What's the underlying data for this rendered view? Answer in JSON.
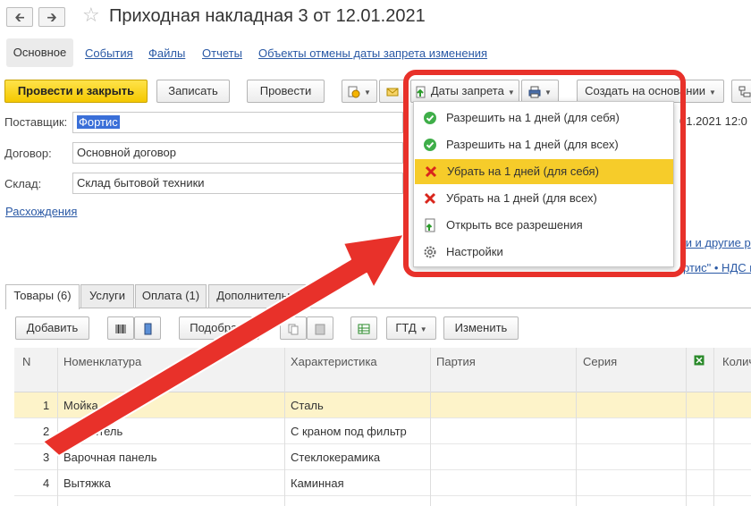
{
  "window": {
    "title": "Приходная накладная 3 от 12.01.2021",
    "back_icon": "arrow-left-icon",
    "forward_icon": "arrow-right-icon",
    "favorite_icon": "star-icon"
  },
  "top_tabs": {
    "main": "Основное",
    "events": "События",
    "files": "Файлы",
    "reports": "Отчеты",
    "objects": "Объекты отмены даты запрета изменения"
  },
  "toolbar": {
    "post_close": "Провести и закрыть",
    "save": "Записать",
    "post": "Провести",
    "dates_ban": "Даты запрета",
    "create_based": "Создать на основании"
  },
  "fields": {
    "supplier_label": "Поставщик:",
    "supplier_value": "Фортис",
    "contract_label": "Договор:",
    "contract_value": "Основной договор",
    "warehouse_label": "Склад:",
    "warehouse_value": "Склад бытовой техники",
    "discrepancies_link": "Расхождения",
    "date_value": "01.2021 12:0",
    "right_link1": "ки и другие р",
    "right_link2": "ртис\" • НДС в"
  },
  "dropdown": {
    "items": [
      {
        "label": "Разрешить на 1 дней (для себя)",
        "icon": "check-circle-icon"
      },
      {
        "label": "Разрешить на 1 дней (для всех)",
        "icon": "check-circle-icon"
      },
      {
        "label": "Убрать на 1 дней (для себя)",
        "icon": "red-x-icon",
        "highlighted": true
      },
      {
        "label": "Убрать на 1 дней (для всех)",
        "icon": "red-x-icon"
      },
      {
        "label": "Открыть все разрешения",
        "icon": "document-icon"
      },
      {
        "label": "Настройки",
        "icon": "gear-icon"
      }
    ]
  },
  "lower_tabs": {
    "goods": "Товары (6)",
    "services": "Услуги",
    "payment": "Оплата (1)",
    "additional": "Дополнительно"
  },
  "table_toolbar": {
    "add": "Добавить",
    "pick": "Подобрать",
    "gtd": "ГТД",
    "change": "Изменить"
  },
  "table": {
    "headers": {
      "n": "N",
      "nomenclature": "Номенклатура",
      "characteristic": "Характеристика",
      "batch": "Партия",
      "series": "Серия",
      "quantity": "Колич"
    },
    "rows": [
      {
        "n": "1",
        "name": "Мойка",
        "char": "Сталь"
      },
      {
        "n": "2",
        "name": "Смеситель",
        "char": "С краном под фильтр"
      },
      {
        "n": "3",
        "name": "Варочная панель",
        "char": "Стеклокерамика"
      },
      {
        "n": "4",
        "name": "Вытяжка",
        "char": "Каминная"
      }
    ]
  },
  "colors": {
    "accent_yellow": "#f6cc2a",
    "link_blue": "#2a59a5",
    "highlight_red": "#e8312a",
    "selected_row": "#fdf3c9"
  }
}
